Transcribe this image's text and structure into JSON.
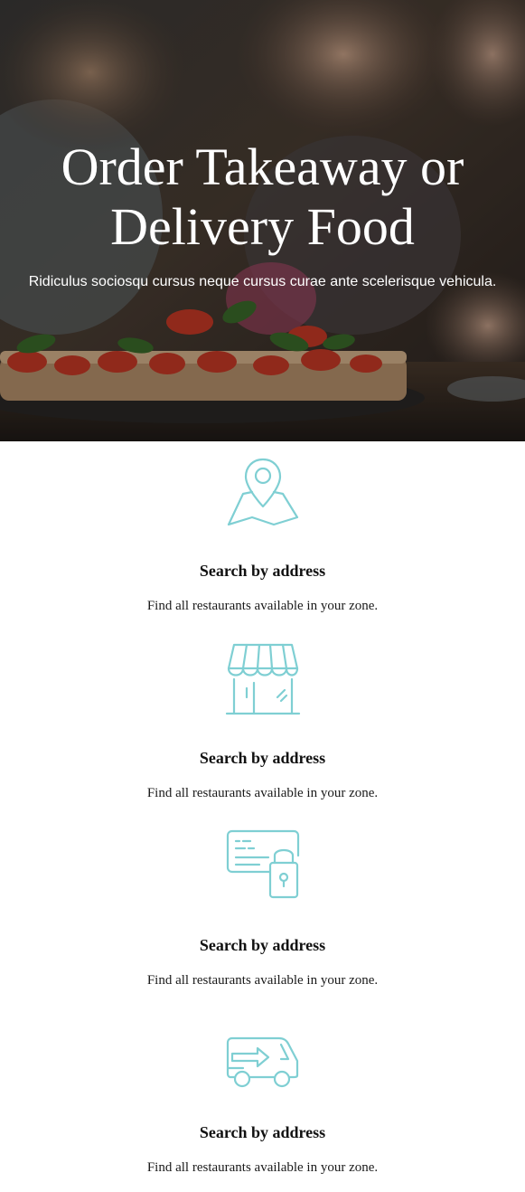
{
  "hero": {
    "title_line1": "Order Takeaway or",
    "title_line2": "Delivery Food",
    "subtitle": "Ridiculus sociosqu cursus neque cursus curae ante scelerisque vehicula."
  },
  "features": [
    {
      "icon": "map-pin-icon",
      "title": "Search by address",
      "description": "Find all restaurants available in your zone."
    },
    {
      "icon": "storefront-icon",
      "title": "Search by address",
      "description": "Find all restaurants available in your zone."
    },
    {
      "icon": "secure-card-icon",
      "title": "Search by address",
      "description": "Find all restaurants available in your zone."
    },
    {
      "icon": "delivery-van-icon",
      "title": "Search by address",
      "description": "Find all restaurants available in your zone."
    }
  ],
  "colors": {
    "icon_accent": "#7fcfd3"
  }
}
